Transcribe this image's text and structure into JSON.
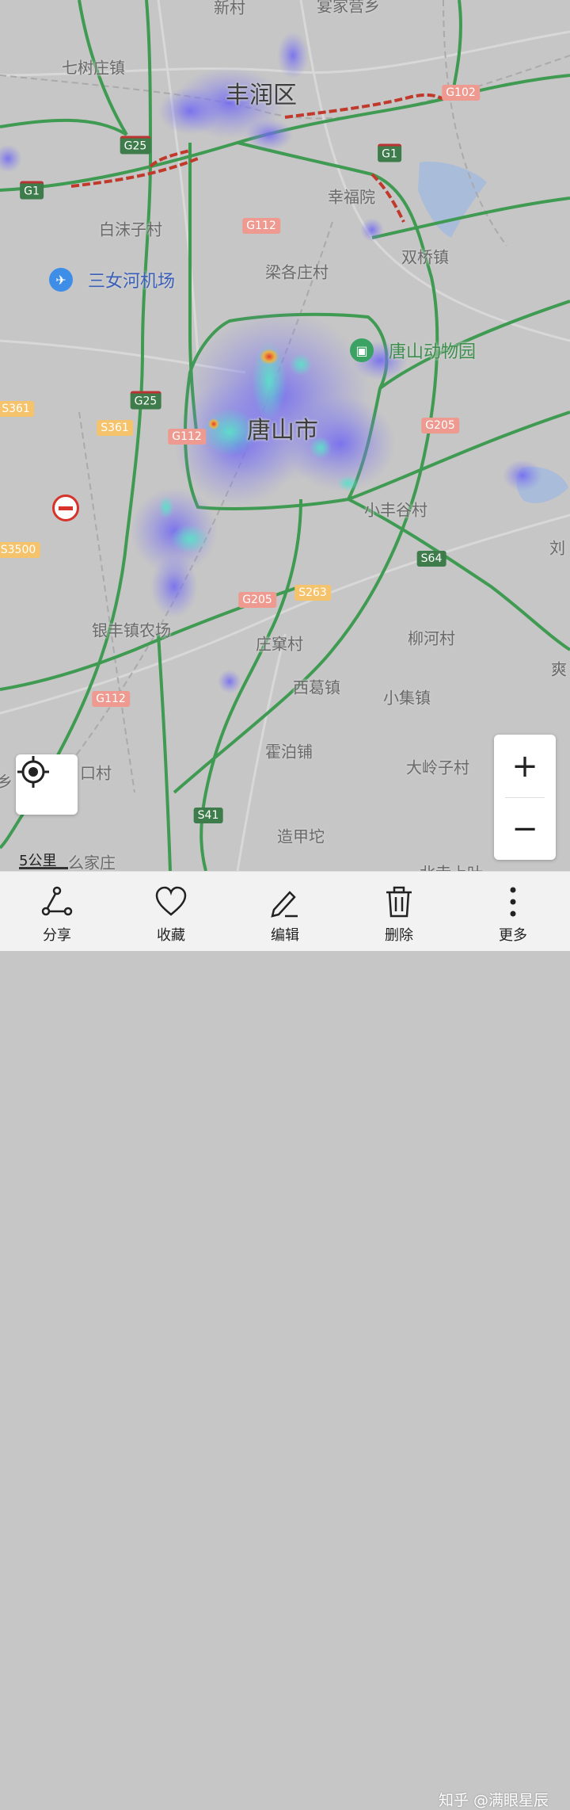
{
  "map": {
    "places": {
      "xincun": "新村",
      "jiajia": "宴家营乡",
      "qishuzhuang": "七树庄镇",
      "fengrun": "丰润区",
      "baimozi": "白沫子村",
      "xingfuyuan": "幸福院",
      "shuangqiao": "双桥镇",
      "lianggezhuang": "梁各庄村",
      "tangshan": "唐山市",
      "xiaofenggu": "小丰谷村",
      "liu": "刘",
      "yinfeng": "银丰镇农场",
      "zhuangkeng": "庄窠村",
      "liuhe": "柳河村",
      "shuang": "爽",
      "xige": "西葛镇",
      "xiaoji": "小集镇",
      "huobo": "霍泊铺",
      "dalingzi": "大岭子村",
      "kou": "口村",
      "zaojiatuo": "造甲坨",
      "yaojiazhuang": "么家庄",
      "xiang": "乡",
      "cut_bottom": "北寺上叶"
    },
    "pois": {
      "airport": "三女河机场",
      "zoo": "唐山动物园"
    },
    "icons": {
      "airport": "airplane-icon",
      "zoo": "bus-icon",
      "no_entry": "no-entry-icon"
    },
    "shields": {
      "g25_top": "G25",
      "g1_left": "G1",
      "g1_right": "G1",
      "g102": "G102",
      "g112_top": "G112",
      "g25_mid": "G25",
      "s361_left": "S361",
      "s361": "S361",
      "g112_mid": "G112",
      "g205_right": "G205",
      "s3500": "S3500",
      "s64": "S64",
      "g205_low": "G205",
      "s263": "S263",
      "g112_low": "G112",
      "s41": "S41"
    },
    "colors": {
      "background": "#c6c6c6",
      "expressway": "#3f9a52",
      "congestion": "#c0392b",
      "heat_low": "#7b72f0",
      "heat_mid": "#4ad8c8",
      "heat_high": "#e24a2c"
    }
  },
  "controls": {
    "locate_icon": "locate-icon",
    "zoom_in": "+",
    "zoom_out": "−",
    "scale_label": "5公里"
  },
  "toolbar": {
    "share": "分享",
    "favorite": "收藏",
    "edit": "编辑",
    "delete": "删除",
    "more": "更多"
  },
  "watermark": "知乎 @满眼星辰"
}
